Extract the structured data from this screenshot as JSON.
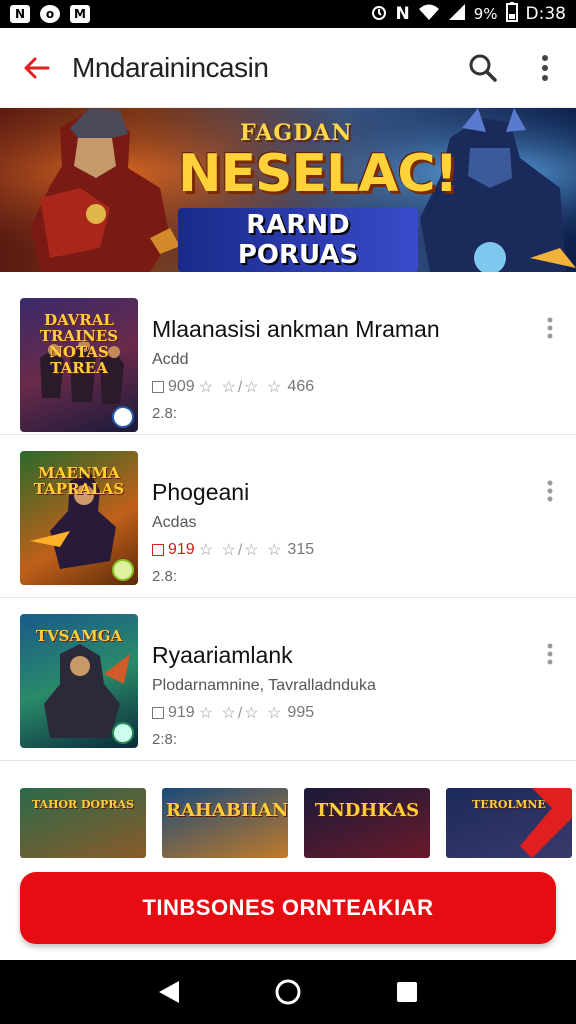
{
  "status_bar": {
    "time": "D:38",
    "battery": "9%",
    "left_icons": [
      "N",
      "o",
      "M"
    ],
    "right_icons": [
      "alarm-icon",
      "nfc-icon",
      "wifi-icon",
      "signal-icon",
      "battery-icon"
    ]
  },
  "app_bar": {
    "title": "Mndarainincasin",
    "back_icon": "back-arrow-icon",
    "actions": [
      "search-icon",
      "more-vert-icon"
    ]
  },
  "banner": {
    "top_text": "FAGDAN",
    "main_text": "NESELAC!",
    "sub_text": "RARND PORUAS"
  },
  "apps": [
    {
      "name": "Mlaanasisi ankman Mraman",
      "genre": "Acdd",
      "price": "909",
      "price_red": false,
      "rating_text": "☆ ☆/☆ ☆",
      "reviews": "466",
      "size": "2.8:",
      "thumb_title": "DAVRAL TRAINES NOTAS TAREA"
    },
    {
      "name": "Phogeani",
      "genre": "Acdas",
      "price": "919",
      "price_red": true,
      "rating_text": "☆ ☆/☆ ☆",
      "reviews": "315",
      "size": "2.8:",
      "thumb_title": "MAENMA TAPRALAS"
    },
    {
      "name": "Ryaariamlank",
      "genre": "Plodarnamnine, Tavralladnduka",
      "price": "919",
      "price_red": false,
      "rating_text": "☆ ☆/☆ ☆",
      "reviews": "995",
      "size": "2:8:",
      "thumb_title": "TVSAMGA"
    }
  ],
  "strip": [
    {
      "text": "TAHOR DOPRAS"
    },
    {
      "text": "RAHABIIAN"
    },
    {
      "text": "TNDHKAS"
    },
    {
      "text": "TEROLMNE"
    }
  ],
  "install_button": "TINBSONES ORNTEAKIAR",
  "colors": {
    "accent": "#e60d12",
    "app_bar_bg": "#ffffff",
    "status_bar_bg": "#000000"
  },
  "nav": [
    "back-triangle-icon",
    "home-circle-icon",
    "recents-square-icon"
  ]
}
